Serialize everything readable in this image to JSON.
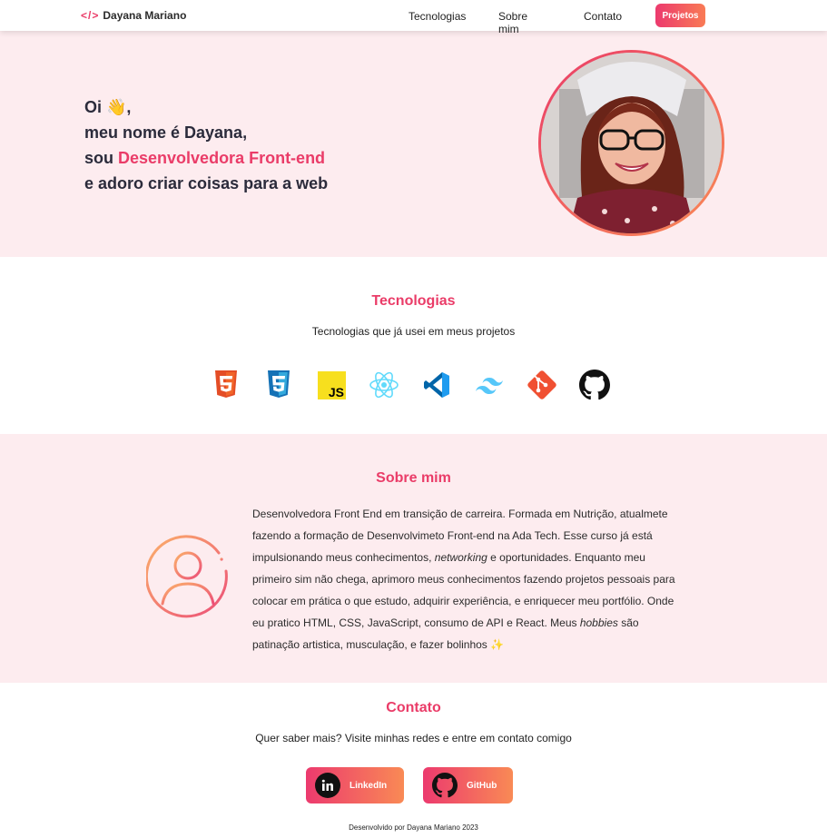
{
  "nav": {
    "logo_code": "</>",
    "logo_name": "Dayana Mariano",
    "links": [
      "Tecnologias",
      "Sobre mim",
      "Contato"
    ],
    "cta": "Projetos"
  },
  "hero": {
    "line1": "Oi 👋,",
    "line2": "meu nome é Dayana,",
    "line3_prefix": "sou ",
    "line3_highlight": "Desenvolvedora Front-end",
    "line4": "e adoro criar coisas para a web"
  },
  "tech": {
    "title": "Tecnologias",
    "subtitle": "Tecnologias que já usei em meus projetos",
    "icons": [
      "html5-icon",
      "css3-icon",
      "javascript-icon",
      "react-icon",
      "vscode-icon",
      "tailwind-icon",
      "git-icon",
      "github-icon"
    ]
  },
  "about": {
    "title": "Sobre mim",
    "p_start": "Desenvolvedora Front End em transição de carreira. Formada em Nutrição, atualmete fazendo a formação de Desenvolvimeto Front-end na Ada Tech. Esse curso já está impulsionando meus conhecimentos, ",
    "p_em1": "networking",
    "p_mid": " e oportunidades. Enquanto meu primeiro sim não chega, aprimoro meus conhecimentos fazendo projetos pessoais para colocar em prática o que estudo, adquirir experiência, e enriquecer meu portfólio. Onde eu pratico HTML, CSS, JavaScript, consumo de API e React. Meus ",
    "p_em2": "hobbies",
    "p_end": " são patinação artistica, musculação, e fazer bolinhos ✨"
  },
  "contact": {
    "title": "Contato",
    "subtitle": "Quer saber mais? Visite minhas redes e entre em contato comigo",
    "linkedin": "LinkedIn",
    "github": "GitHub",
    "footer": "Desenvolvido por Dayana Mariano 2023"
  },
  "colors": {
    "accent": "#ea3c68",
    "accent2": "#f98a55",
    "pink_bg": "#fdecef"
  }
}
